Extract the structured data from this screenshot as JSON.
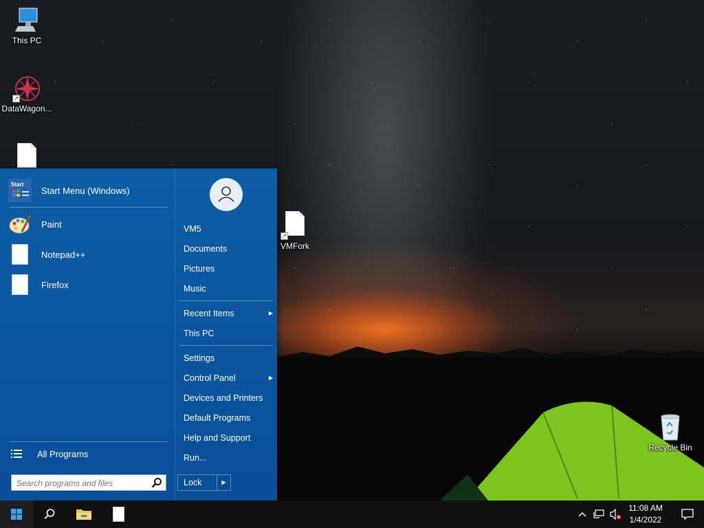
{
  "desktop": {
    "icons": [
      {
        "label": "This PC"
      },
      {
        "label": "DataWagon..."
      },
      {
        "label": ""
      },
      {
        "label": "VMFork"
      },
      {
        "label": "Recycle Bin"
      }
    ]
  },
  "start_menu": {
    "pinned": [
      {
        "label": "Start Menu (Windows)",
        "icon": "start-menu-icon"
      },
      {
        "label": "Paint",
        "icon": "paint-icon"
      },
      {
        "label": "Notepad++",
        "icon": "file-icon"
      },
      {
        "label": "Firefox",
        "icon": "file-icon"
      }
    ],
    "all_programs_label": "All Programs",
    "search_placeholder": "Search programs and files",
    "right_items": [
      {
        "label": "VM5"
      },
      {
        "label": "Documents"
      },
      {
        "label": "Pictures"
      },
      {
        "label": "Music"
      },
      {
        "label": "Recent Items",
        "submenu": true
      },
      {
        "label": "This PC"
      },
      {
        "label": "Settings"
      },
      {
        "label": "Control Panel",
        "submenu": true
      },
      {
        "label": "Devices and Printers"
      },
      {
        "label": "Default Programs"
      },
      {
        "label": "Help and Support"
      },
      {
        "label": "Run..."
      }
    ],
    "lock_label": "Lock",
    "accent_color": "#0b55a0"
  },
  "taskbar": {
    "time": "11:08 AM",
    "date": "1/4/2022",
    "icons": [
      "windows-start-icon",
      "search-icon",
      "file-explorer-icon",
      "document-icon"
    ],
    "tray_icons": [
      "chevron-up-icon",
      "network-icon",
      "volume-muted-icon",
      "action-center-icon"
    ]
  }
}
